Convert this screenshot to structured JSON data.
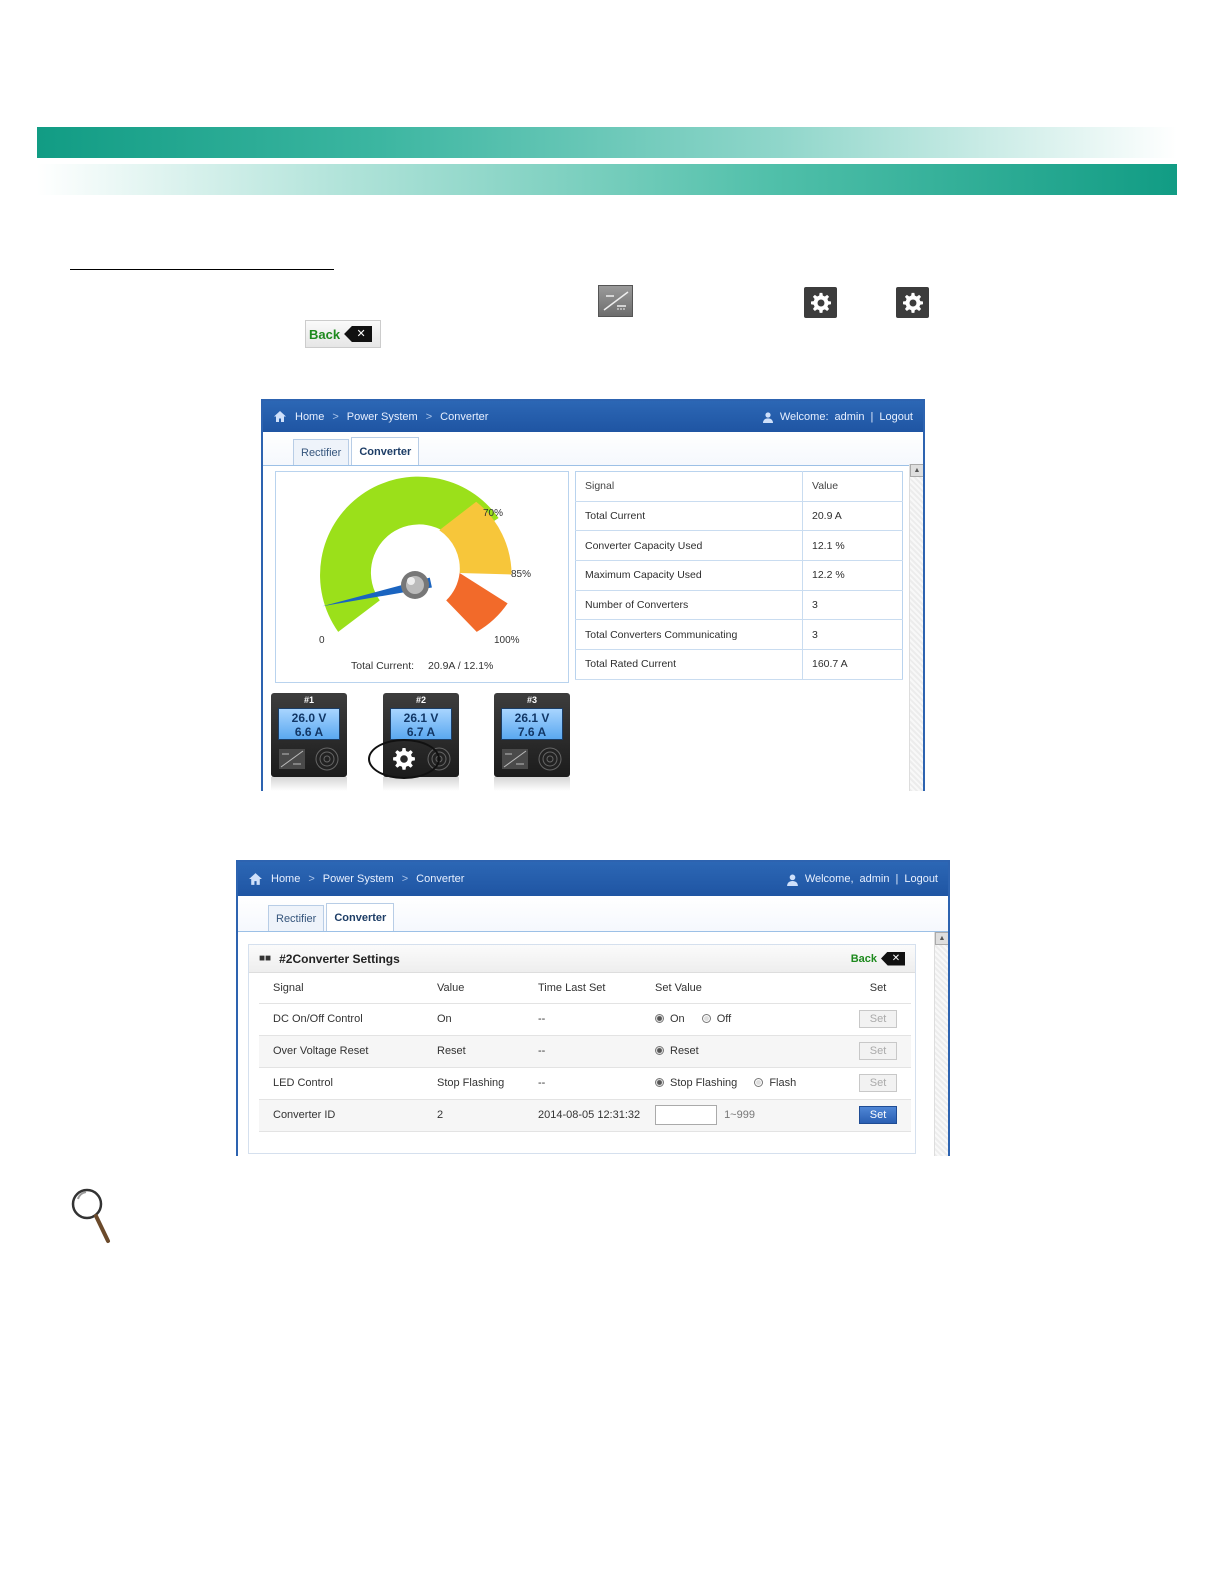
{
  "inline": {
    "back_label": "Back"
  },
  "shot1": {
    "breadcrumb": [
      "Home",
      "Power System",
      "Converter"
    ],
    "welcome": "Welcome:",
    "user": "admin",
    "divider": "|",
    "logout": "Logout",
    "tabs": [
      "Rectifier",
      "Converter"
    ],
    "gauge": {
      "labels": {
        "zero": "0",
        "p70": "70%",
        "p85": "85%",
        "p100": "100%"
      },
      "total_label": "Total Current:",
      "total_value": "20.9A / 12.1%",
      "needle_percent": 12.1
    },
    "table": {
      "header": [
        "Signal",
        "Value"
      ],
      "rows": [
        [
          "Total Current",
          "20.9 A"
        ],
        [
          "Converter Capacity Used",
          "12.1 %"
        ],
        [
          "Maximum Capacity Used",
          "12.2 %"
        ],
        [
          "Number of Converters",
          "3"
        ],
        [
          "Total Converters Communicating",
          "3"
        ],
        [
          "Total Rated Current",
          "160.7 A"
        ]
      ]
    },
    "modules": [
      {
        "label": "#1",
        "volt": "26.0 V",
        "amp": "6.6 A"
      },
      {
        "label": "#2",
        "volt": "26.1 V",
        "amp": "6.7 A"
      },
      {
        "label": "#3",
        "volt": "26.1 V",
        "amp": "7.6 A"
      }
    ]
  },
  "shot2": {
    "breadcrumb": [
      "Home",
      "Power System",
      "Converter"
    ],
    "welcome": "Welcome,",
    "user": "admin",
    "divider": "|",
    "logout": "Logout",
    "tabs": [
      "Rectifier",
      "Converter"
    ],
    "panel_title": "#2Converter Settings",
    "back_label": "Back",
    "columns": [
      "Signal",
      "Value",
      "Time Last Set",
      "Set Value",
      "Set"
    ],
    "rows": [
      {
        "signal": "DC On/Off Control",
        "value": "On",
        "time": "--",
        "opt1": "On",
        "opt2": "Off",
        "btn": "Set"
      },
      {
        "signal": "Over Voltage Reset",
        "value": "Reset",
        "time": "--",
        "opt1": "Reset",
        "btn": "Set"
      },
      {
        "signal": "LED Control",
        "value": "Stop Flashing",
        "time": "--",
        "opt1": "Stop Flashing",
        "opt2": "Flash",
        "btn": "Set"
      },
      {
        "signal": "Converter ID",
        "value": "2",
        "time": "2014-08-05 12:31:32",
        "range": "1~999",
        "btn": "Set"
      }
    ]
  },
  "colors": {
    "teal": "#119c84",
    "header_blue": "#2c67b5",
    "gauge_green": "#9be01a",
    "gauge_yellow": "#f7c63a",
    "gauge_orange": "#f26a2a",
    "needle_blue": "#1a64c0"
  }
}
